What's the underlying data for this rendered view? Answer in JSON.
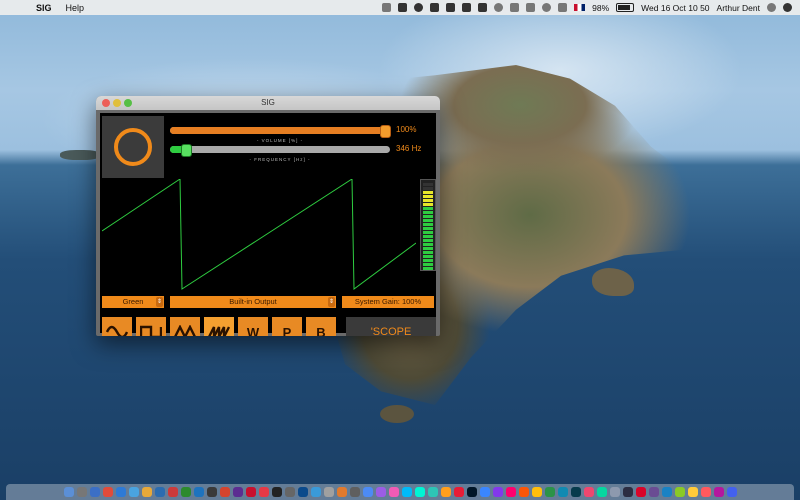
{
  "menubar": {
    "app_name": "SIG",
    "menus": [
      "Help"
    ],
    "battery": "98%",
    "clock": "Wed 16 Oct  10 50",
    "user": "Arthur Dent"
  },
  "window": {
    "title": "SIG",
    "volume": {
      "label": "- VOLUME [%] -",
      "value": "100%",
      "level": 1.0
    },
    "frequency": {
      "label": "- FREQUENCY [Hz] -",
      "value": "346 Hz",
      "level": 0.05
    },
    "color_select": "Green",
    "output_select": "Built-in Output",
    "system_gain": "System Gain: 100%",
    "waveforms": [
      {
        "name": "sine",
        "glyph": "∿"
      },
      {
        "name": "square",
        "glyph": "⊓⊔"
      },
      {
        "name": "triangle",
        "glyph": "⋀⋀"
      },
      {
        "name": "sawtooth",
        "glyph": "⩘⩘"
      },
      {
        "name": "white-noise",
        "glyph": "W"
      },
      {
        "name": "pink-noise",
        "glyph": "P"
      },
      {
        "name": "brown-noise",
        "glyph": "B"
      }
    ],
    "selected_waveform": "sawtooth",
    "scope_button": "'SCOPE",
    "colors": {
      "accent": "#f08a1a",
      "trace": "#2ecc40"
    }
  },
  "dock": {
    "app_colors": [
      "#5b8fd6",
      "#777",
      "#3b6fc6",
      "#e04b3a",
      "#2d7ad6",
      "#4aa3df",
      "#e7a93a",
      "#2b6cb0",
      "#cc3b3b",
      "#2d8a2d",
      "#1e73be",
      "#3a3a3a",
      "#d4442e",
      "#5c2d91",
      "#c8102e",
      "#e63946",
      "#222",
      "#666",
      "#0b4a8b",
      "#3a9ad9",
      "#a0a0a0",
      "#e07a2e",
      "#5f5f5f",
      "#4c8bf5",
      "#9b5de5",
      "#f15bb5",
      "#00bbf9",
      "#00f5d4",
      "#2ec4b6",
      "#ff9f1c",
      "#e71d36",
      "#011627",
      "#3a86ff",
      "#8338ec",
      "#ff006e",
      "#fb5607",
      "#ffbe0b",
      "#2b9348",
      "#118ab2",
      "#073b4c",
      "#ef476f",
      "#06d6a0",
      "#8d99ae",
      "#2b2d42",
      "#d90429",
      "#6a4c93",
      "#1982c4",
      "#8ac926",
      "#ffca3a",
      "#ff595e",
      "#b5179e",
      "#4361ee"
    ]
  }
}
